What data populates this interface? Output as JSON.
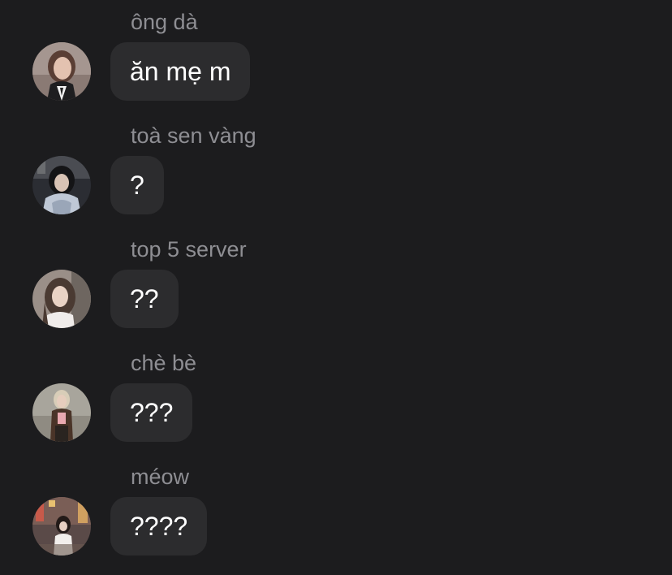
{
  "messages": [
    {
      "sender": "ông dà",
      "text": "ăn mẹ m",
      "avatar_icon": "profile-photo-woman-suit"
    },
    {
      "sender": "toà sen vàng",
      "text": "?",
      "avatar_icon": "profile-photo-woman-dark-hair"
    },
    {
      "sender": "top 5 server",
      "text": "??",
      "avatar_icon": "profile-photo-woman-long-hair"
    },
    {
      "sender": "chè bè",
      "text": "???",
      "avatar_icon": "profile-photo-woman-blonde-jacket"
    },
    {
      "sender": "méow",
      "text": "????",
      "avatar_icon": "profile-photo-woman-city-night"
    }
  ],
  "colors": {
    "background": "#1c1c1e",
    "bubble": "#2c2c2e",
    "sender_text": "#8e8e93",
    "message_text": "#ffffff"
  }
}
